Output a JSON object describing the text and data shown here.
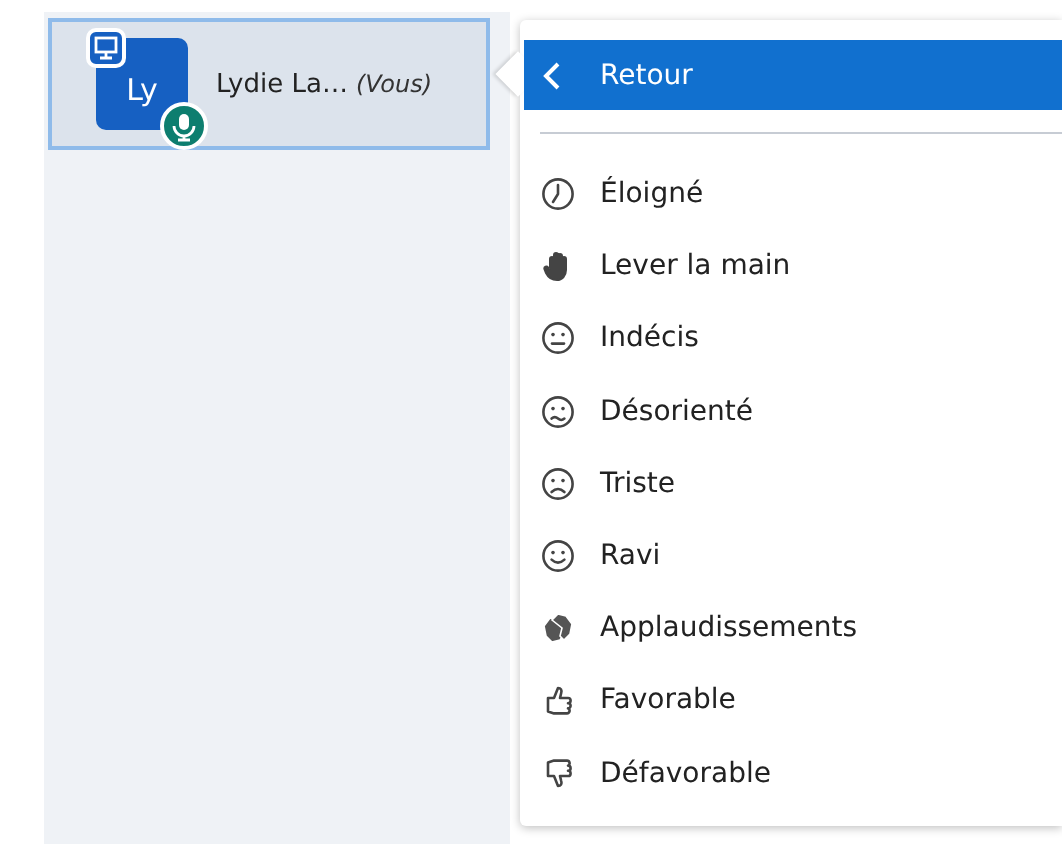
{
  "participant": {
    "initials": "Ly",
    "name": "Lydie La…",
    "suffix": "(Vous)",
    "selected": true
  },
  "menu": {
    "back": "Retour",
    "items": [
      {
        "kind": "clock",
        "label": "Éloigné"
      },
      {
        "kind": "hand",
        "label": "Lever la main"
      },
      {
        "kind": "neutral",
        "label": "Indécis"
      },
      {
        "kind": "confused",
        "label": "Désorienté"
      },
      {
        "kind": "sad",
        "label": "Triste"
      },
      {
        "kind": "happy",
        "label": "Ravi"
      },
      {
        "kind": "clap",
        "label": "Applaudissements"
      },
      {
        "kind": "thumbup",
        "label": "Favorable"
      },
      {
        "kind": "thumbdown",
        "label": "Défavorable"
      }
    ]
  }
}
